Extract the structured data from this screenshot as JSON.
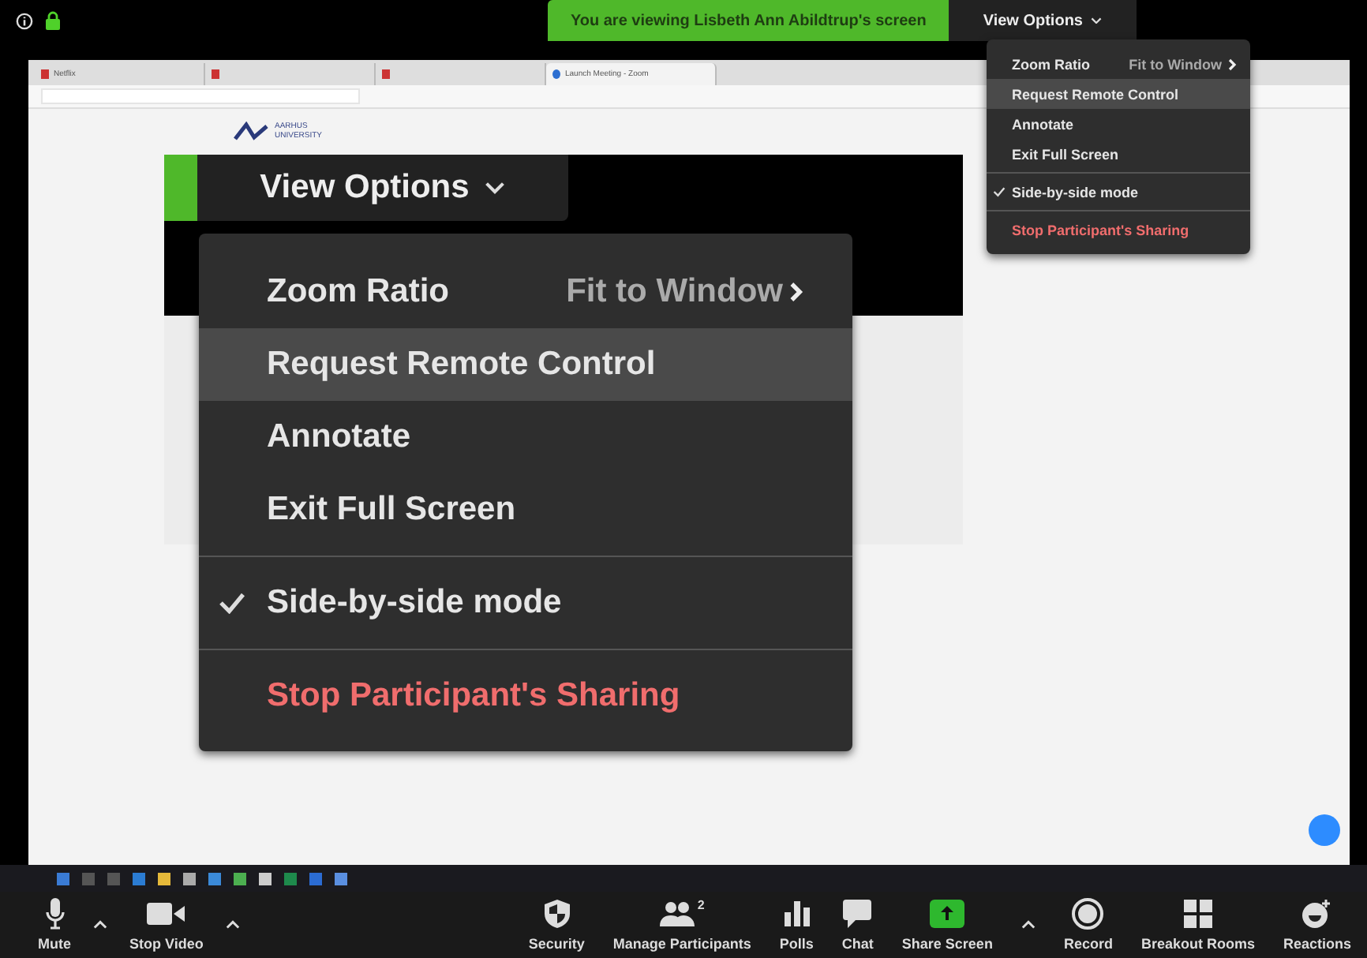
{
  "top_bar": {
    "banner": "You are viewing Lisbeth Ann Abildtrup's screen",
    "view_options": "View Options"
  },
  "shared_screen": {
    "tabs": [
      {
        "title": "Netflix",
        "selected": false
      },
      {
        "selected": false
      },
      {
        "selected": false
      },
      {
        "title": "Launch Meeting - Zoom",
        "selected": true
      }
    ],
    "logo": [
      "AARHUS",
      "UNIVERSITY"
    ]
  },
  "view_menu": {
    "groups": [
      {
        "items": [
          {
            "kind": "submenu",
            "label": "Zoom Ratio",
            "value": "Fit to Window",
            "highlighted": false
          },
          {
            "kind": "action",
            "label": "Request Remote Control",
            "highlighted": true
          },
          {
            "kind": "action",
            "label": "Annotate",
            "highlighted": false
          },
          {
            "kind": "action",
            "label": "Exit Full Screen",
            "highlighted": false
          }
        ]
      },
      {
        "items": [
          {
            "kind": "toggle",
            "label": "Side-by-side mode",
            "checked": true,
            "highlighted": false
          }
        ]
      },
      {
        "items": [
          {
            "kind": "danger",
            "label": "Stop Participant's Sharing",
            "highlighted": false
          }
        ]
      }
    ]
  },
  "magnified": {
    "view_options": "View Options",
    "menu": {
      "groups": [
        {
          "items": [
            {
              "kind": "submenu",
              "label": "Zoom Ratio",
              "value": "Fit to Window",
              "highlighted": false
            },
            {
              "kind": "action",
              "label": "Request Remote Control",
              "highlighted": true
            },
            {
              "kind": "action",
              "label": "Annotate",
              "highlighted": false
            },
            {
              "kind": "action",
              "label": "Exit Full Screen",
              "highlighted": false
            }
          ]
        },
        {
          "items": [
            {
              "kind": "toggle",
              "label": "Side-by-side mode",
              "checked": true,
              "highlighted": false
            }
          ]
        },
        {
          "items": [
            {
              "kind": "danger",
              "label": "Stop Participant's Sharing",
              "highlighted": false
            }
          ]
        }
      ]
    }
  },
  "toolbar": {
    "left": [
      {
        "kind": "audio",
        "label": "Mute",
        "caret": true
      },
      {
        "kind": "video",
        "label": "Stop Video",
        "caret": true
      }
    ],
    "right": [
      {
        "kind": "security",
        "label": "Security",
        "caret": false
      },
      {
        "kind": "participants",
        "label": "Manage Participants",
        "badge": "2",
        "caret": false
      },
      {
        "kind": "polls",
        "label": "Polls",
        "caret": false
      },
      {
        "kind": "chat",
        "label": "Chat",
        "caret": false
      },
      {
        "kind": "share",
        "label": "Share Screen",
        "caret": true
      },
      {
        "kind": "record",
        "label": "Record",
        "caret": false
      },
      {
        "kind": "breakout",
        "label": "Breakout Rooms",
        "caret": false
      },
      {
        "kind": "reactions",
        "label": "Reactions",
        "caret": false
      }
    ]
  }
}
